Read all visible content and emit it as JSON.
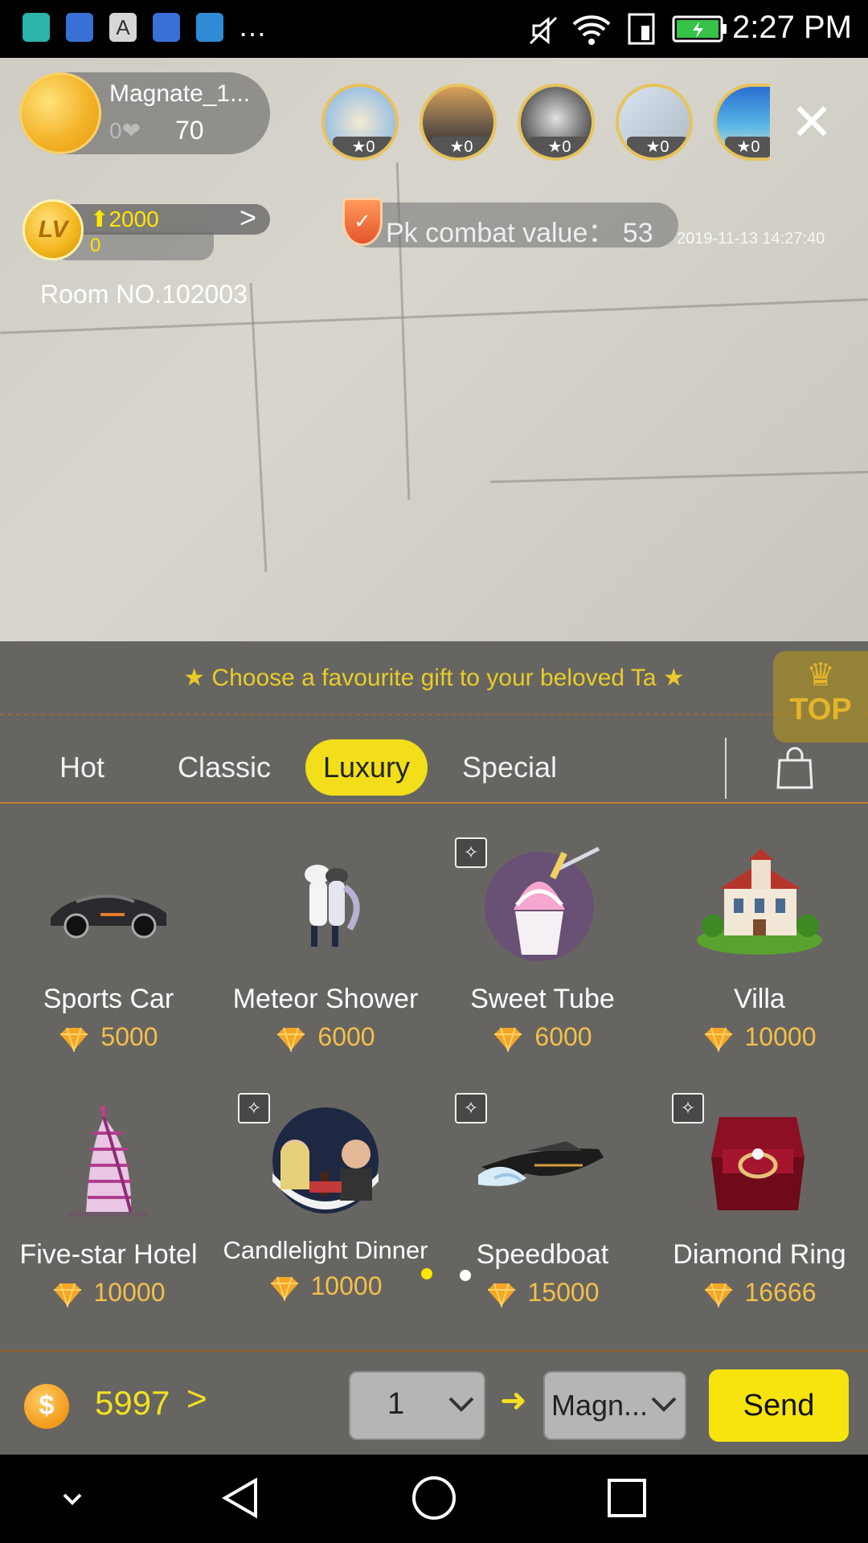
{
  "status_bar": {
    "time": "2:27 PM",
    "more": "…",
    "icons": [
      "android-icon",
      "baidu-icon",
      "font-icon",
      "baidu-icon",
      "telegram-icon",
      "mute-icon",
      "wifi-icon",
      "data-icon",
      "battery-icon"
    ]
  },
  "host": {
    "name": "Magnate_1...",
    "likes": "70",
    "heart": "0❤"
  },
  "viewers": [
    {
      "badge": "★0"
    },
    {
      "badge": "★0"
    },
    {
      "badge": "★0"
    },
    {
      "badge": "★0"
    },
    {
      "badge": "★0"
    }
  ],
  "level": {
    "coin": "LV",
    "up": "⬆2000",
    "zero": "0",
    "arrow": ">"
  },
  "pk": {
    "label": "Pk combat value： 53"
  },
  "timestamp": "2019-11-13 14:27:40",
  "room": "Room NO.102003",
  "gift_panel": {
    "hint": "★  Choose a favourite gift to your beloved Ta  ★",
    "top_label": "TOP",
    "tabs": [
      {
        "label": "Hot",
        "active": false
      },
      {
        "label": "Classic",
        "active": false
      },
      {
        "label": "Luxury",
        "active": true
      },
      {
        "label": "Special",
        "active": false
      }
    ],
    "gifts": [
      {
        "name": "Sports Car",
        "price": "5000",
        "fx": false
      },
      {
        "name": "Meteor Shower",
        "price": "6000",
        "fx": false
      },
      {
        "name": "Sweet Tube",
        "price": "6000",
        "fx": true
      },
      {
        "name": "Villa",
        "price": "10000",
        "fx": false
      },
      {
        "name": "Five-star Hotel",
        "price": "10000",
        "fx": false
      },
      {
        "name": "Candlelight Dinner",
        "price": "10000",
        "fx": true
      },
      {
        "name": "Speedboat",
        "price": "15000",
        "fx": true
      },
      {
        "name": "Diamond Ring",
        "price": "16666",
        "fx": true
      }
    ],
    "fx_glyph": "✧"
  },
  "action_bar": {
    "coin_symbol": "$",
    "balance": "5997",
    "balance_arrow": ">",
    "quantity": "1",
    "recipient": "Magn...",
    "send_label": "Send"
  },
  "colors": {
    "accent_yellow": "#f7e40d",
    "panel_bg": "#676561",
    "price_gold": "#f3c04a"
  }
}
